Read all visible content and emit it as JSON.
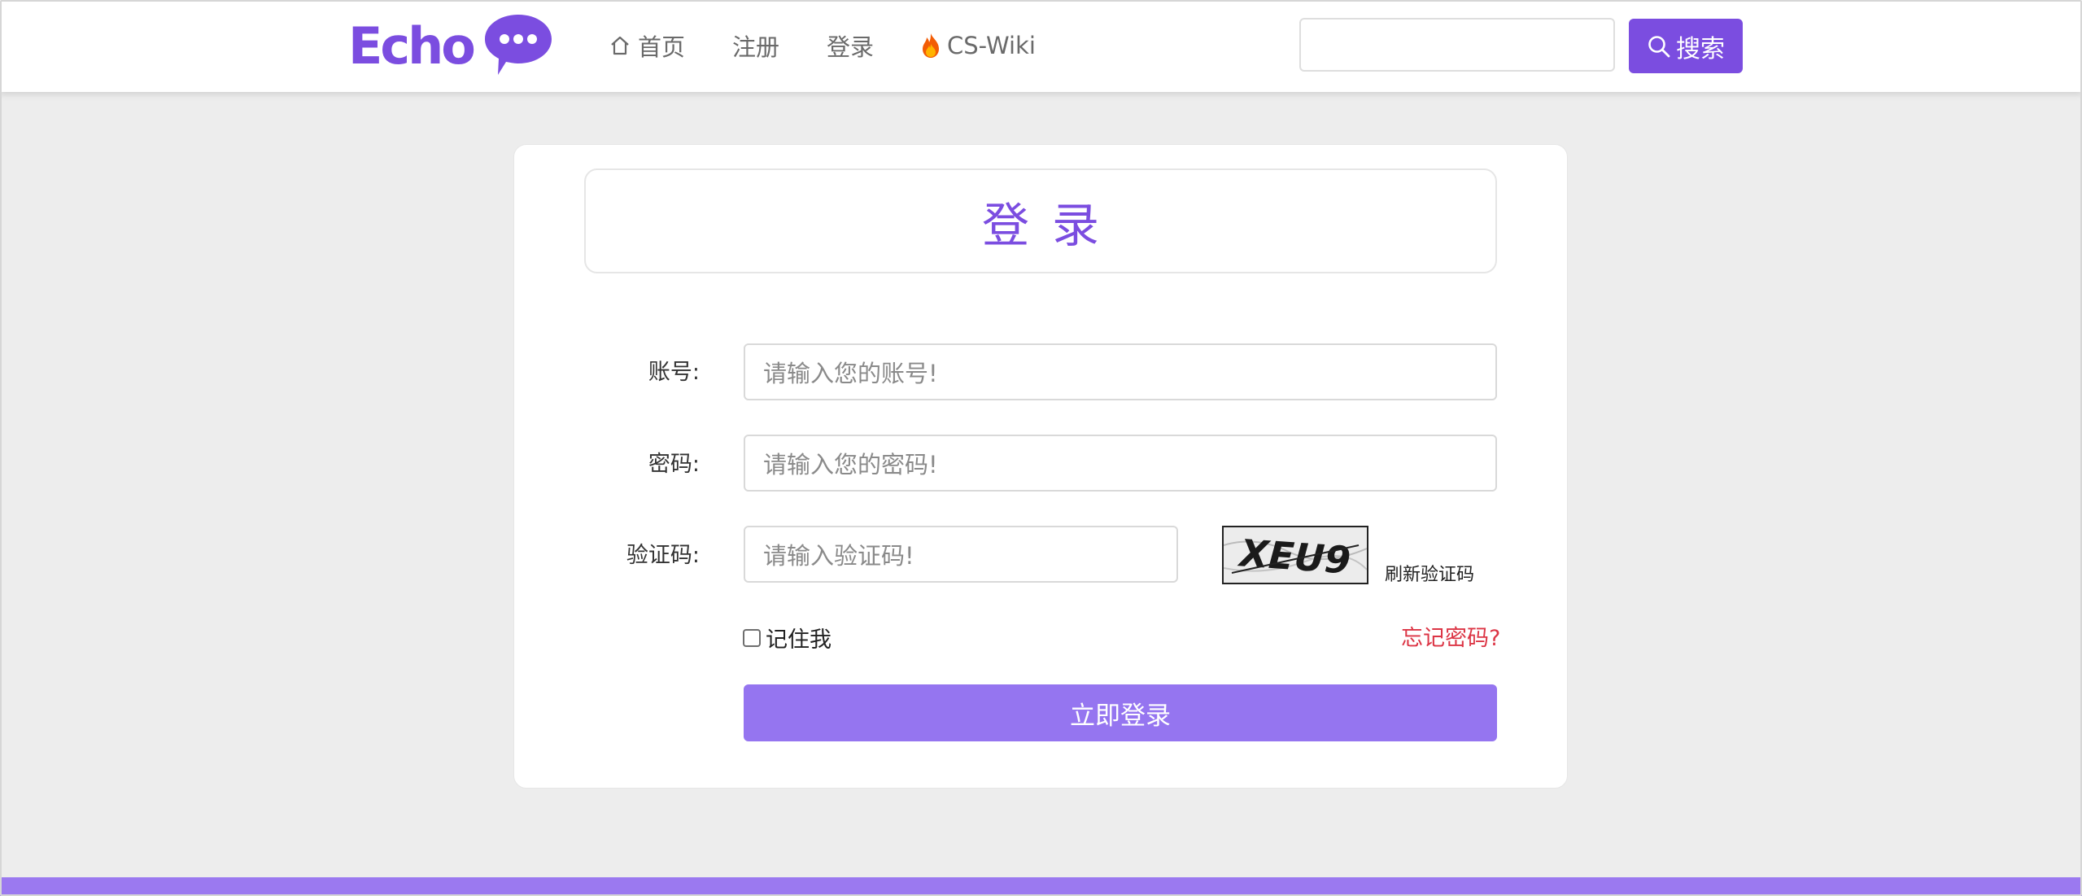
{
  "brand": {
    "name": "Echo",
    "accent": "#7b4de0",
    "button_color": "#9575f0",
    "danger": "#dc3545"
  },
  "nav": {
    "home": "首页",
    "register": "注册",
    "login": "登录",
    "wiki": "CS-Wiki"
  },
  "search": {
    "placeholder": "",
    "button_label": "搜索"
  },
  "login_form": {
    "title": "登录",
    "account_label": "账号:",
    "account_placeholder": "请输入您的账号!",
    "password_label": "密码:",
    "password_placeholder": "请输入您的密码!",
    "captcha_label": "验证码:",
    "captcha_placeholder": "请输入验证码!",
    "captcha_text": "XEU9",
    "refresh_captcha": "刷新验证码",
    "remember_me": "记住我",
    "forgot_password": "忘记密码?",
    "submit": "立即登录"
  },
  "icons": {
    "home": "home-icon",
    "fire": "fire-icon",
    "search": "search-icon",
    "logo_bubble": "chat-bubble-icon"
  }
}
